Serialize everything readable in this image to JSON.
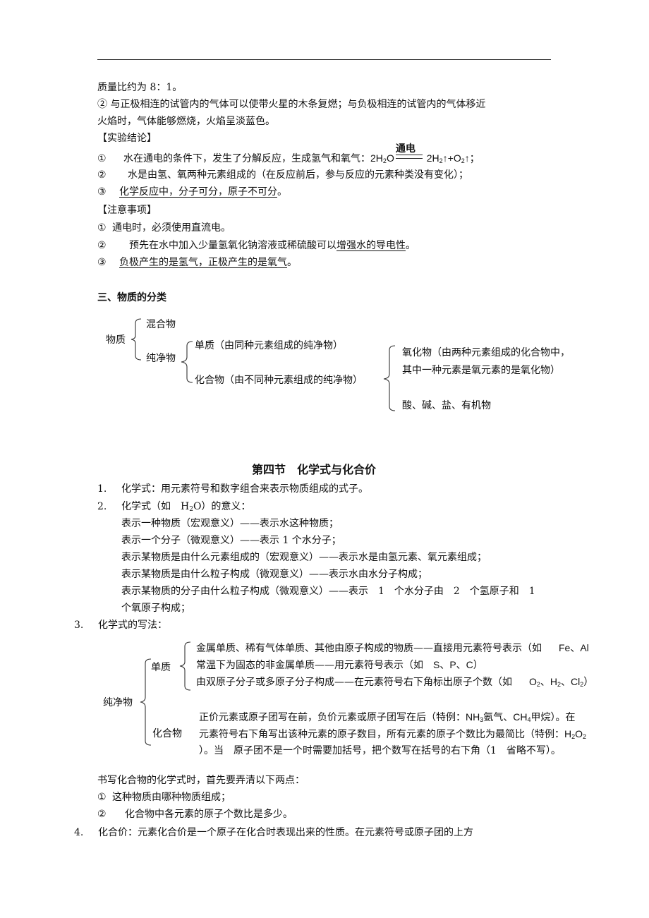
{
  "top_continuation": {
    "line1": "质量比约为 8：1。",
    "line2a": "② 与正极相连的试管内的气体可以使带火星的木条复燃；与负极相连的试管内的气体移近",
    "line2b": "火焰时，气体能够燃烧，火焰呈淡蓝色。"
  },
  "conclusion": {
    "title": "【实验结论】",
    "items": [
      {
        "num": "①",
        "text": "水在通电的条件下，发生了分解反应，生成氢气和氧气：",
        "equation": {
          "reactant": "2H",
          "reactant_sub": "2",
          "reactant_tail": "O",
          "condition": "通电",
          "product1": "2H",
          "product1_sub": "2",
          "arrow1": "↑+O",
          "product2_sub": "2",
          "arrow2": "↑；"
        }
      },
      {
        "num": "②",
        "text": "水是由氢、氧两种元素组成的（在反应前后，参与反应的元素种类没有变化）；"
      },
      {
        "num": "③",
        "text": "化学反应中，分子可分，原子不可分",
        "tail": "。"
      }
    ]
  },
  "notes": {
    "title": "【注意事项】",
    "items": [
      {
        "num": "①",
        "text": "通电时，必须使用直流电。"
      },
      {
        "num": "②",
        "text": "预先在水中加入少量氢氧化钠溶液或稀硫酸可以",
        "underlined": "增强水的导电性",
        "tail": "。"
      },
      {
        "num": "③",
        "underlined": "负极产生的是氢气，正极产生的是氧气",
        "tail": "。"
      }
    ]
  },
  "classification": {
    "title": "三、物质的分类",
    "root": "物质",
    "mixture": "混合物",
    "pure": "纯净物",
    "element": "单质（由同种元素组成的纯净物）",
    "compound": "化合物（由不同种元素组成的纯净物）",
    "oxide_line1": "氧化物（由两种元素组成的化合物中，",
    "oxide_line2": "其中一种元素是氧元素的是氧化物）",
    "others": "酸、碱、盐、有机物"
  },
  "section4": {
    "title": "第四节　化学式与化合价",
    "item1": {
      "num": "1.",
      "text": "化学式：用元素符号和数字组合来表示物质组成的式子。"
    },
    "item2": {
      "num": "2.",
      "text_a": "化学式（如　H",
      "text_sub": "2",
      "text_b": "O）的意义：",
      "lines": [
        "表示一种物质（宏观意义）——表示水这种物质；",
        "表示一个分子（微观意义）——表示 1 个水分子；",
        "表示某物质是由什么元素组成的（宏观意义）——表示水是由氢元素、氧元素组成；",
        "表示某物质是由什么粒子构成（微观意义）——表示水由水分子构成；",
        "表示某物质的分子由什么粒子构成（微观意义）——表示　1　个水分子由　2　个氢原子和　1",
        "个氧原子构成；"
      ]
    },
    "item3": {
      "num": "3.",
      "text": "化学式的写法：",
      "tree": {
        "root": "纯净物",
        "element": "单质",
        "element_rules": [
          {
            "text": "金属单质、稀有气体单质、其他由原子构成的物质——直接用元素符号表示（如",
            "example": "Fe、Al"
          },
          {
            "text": "常温下为固态的非金属单质——用元素符号表示（如",
            "example": "S、P、C）"
          },
          {
            "text": "由双原子分子或多原子分子构成——在元素符号右下角标出原子个数（如",
            "example_parts": [
              "O",
              "2",
              "、H",
              "2",
              "、Cl",
              "2",
              "）"
            ]
          }
        ],
        "compound": "化合物",
        "compound_lines": {
          "l1_a": "正价元素或原子团写在前，负价元素或原子团写在后（特例：",
          "l1_nh": "NH",
          "l1_nh_sub": "3",
          "l1_b": "氨气、",
          "l1_ch": "CH",
          "l1_ch_sub": "4",
          "l1_c": "甲烷）。在",
          "l2_a": "元素符号右下角写出该种元素的原子数目，所有元素的原子个数比为最简比（特例：",
          "l2_h": "H",
          "l2_h_sub": "2",
          "l2_o": "O",
          "l2_o_sub": "2",
          "l3": "）。当　原子团不是一个时需要加括号，把个数写在括号的右下角（1　省略不写）。"
        }
      }
    },
    "writing_tips": {
      "intro": "书写化合物的化学式时，首先要弄清以下两点：",
      "items": [
        {
          "num": "①",
          "text": "这种物质由哪种物质组成；"
        },
        {
          "num": "②",
          "text": "化合物中各元素的原子个数比是多少。"
        }
      ]
    },
    "item4": {
      "num": "4.",
      "text": "化合价：元素化合价是一个原子在化合时表现出来的性质。在元素符号或原子团的上方"
    }
  }
}
